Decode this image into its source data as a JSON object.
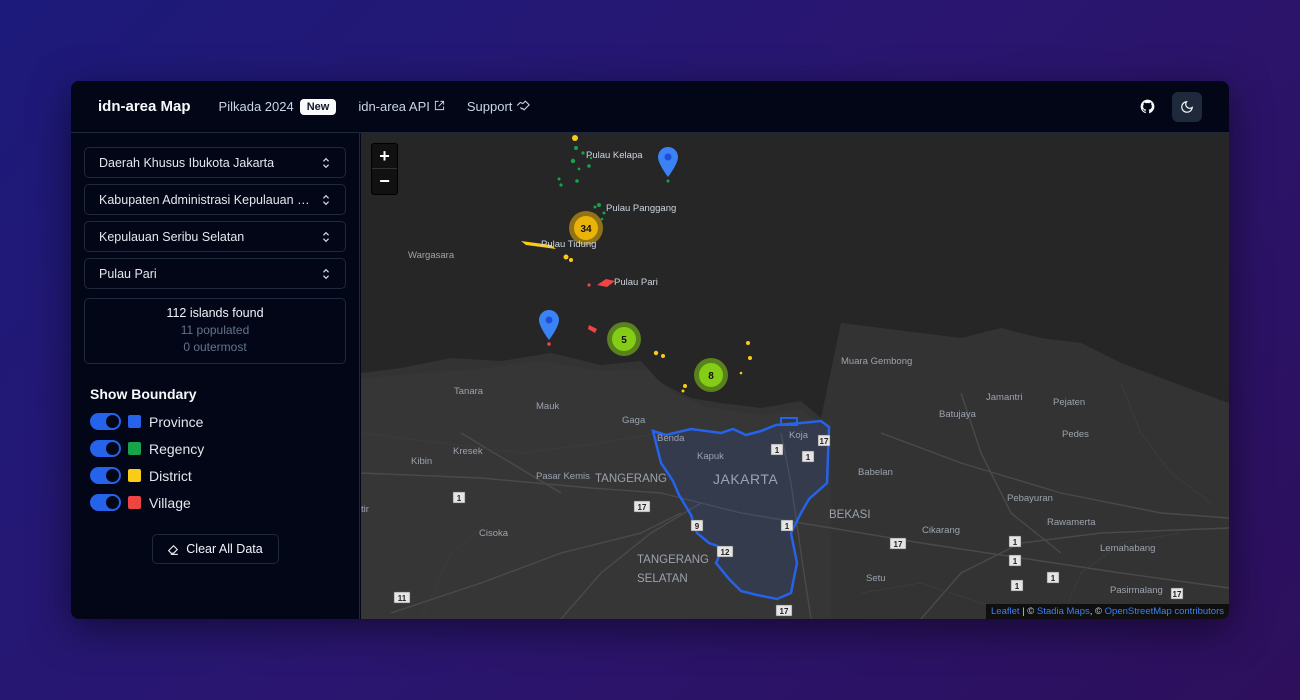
{
  "header": {
    "brand": "idn-area Map",
    "nav": [
      {
        "label": "Pilkada 2024",
        "badge": "New"
      },
      {
        "label": "idn-area API"
      },
      {
        "label": "Support"
      }
    ]
  },
  "sidebar": {
    "selects": [
      "Daerah Khusus Ibukota Jakarta",
      "Kabupaten Administrasi Kepulauan Seribu",
      "Kepulauan Seribu Selatan",
      "Pulau Pari"
    ],
    "stats": {
      "found": "112 islands found",
      "populated": "11 populated",
      "outermost": "0 outermost"
    },
    "boundary_title": "Show Boundary",
    "boundaries": [
      {
        "label": "Province",
        "color": "#2563eb"
      },
      {
        "label": "Regency",
        "color": "#16a34a"
      },
      {
        "label": "District",
        "color": "#facc15"
      },
      {
        "label": "Village",
        "color": "#ef4444"
      }
    ],
    "clear_label": "Clear All Data"
  },
  "map": {
    "zoom_in": "+",
    "zoom_out": "−",
    "clusters": [
      {
        "count": "34",
        "color": "#eab308"
      },
      {
        "count": "5",
        "color": "#84cc16"
      },
      {
        "count": "8",
        "color": "#84cc16"
      }
    ],
    "labels": {
      "pulau_kelapa": "Pulau Kelapa",
      "pulau_panggang": "Pulau Panggang",
      "pulau_tidung": "Pulau Tidung",
      "wargasara": "Wargasara",
      "pulau_pari": "Pulau Pari",
      "muara_gembong": "Muara Gembong",
      "tanara": "Tanara",
      "mauk": "Mauk",
      "gaga": "Gaga",
      "benda": "Benda",
      "koja": "Koja",
      "batujaya": "Batujaya",
      "jamantri": "Jamantri",
      "pejaten": "Pejaten",
      "pedes": "Pedes",
      "kresek": "Kresek",
      "kibin": "Kibin",
      "kapuk": "Kapuk",
      "pasar_kemis": "Pasar Kemis",
      "tangerang": "TANGERANG",
      "jakarta": "JAKARTA",
      "babelan": "Babelan",
      "bekasi": "BEKASI",
      "pebayuran": "Pebayuran",
      "rawamerta": "Rawamerta",
      "cikarang": "Cikarang",
      "lemahabang": "Lemahabang",
      "cisoka": "Cisoka",
      "tangerang_selatan_1": "TANGERANG",
      "tangerang_selatan_2": "SELATAN",
      "setu": "Setu",
      "pasirmalang": "Pasirmalang",
      "tir": "tir"
    },
    "road_shields": [
      "1",
      "17",
      "1",
      "1",
      "17",
      "9",
      "1",
      "12",
      "17",
      "1",
      "17",
      "1",
      "1",
      "11",
      "17",
      "1"
    ],
    "attribution": {
      "leaflet": "Leaflet",
      "sep": " | © ",
      "stadia": "Stadia Maps",
      "sep2": ", © ",
      "osm": "OpenStreetMap contributors"
    }
  }
}
